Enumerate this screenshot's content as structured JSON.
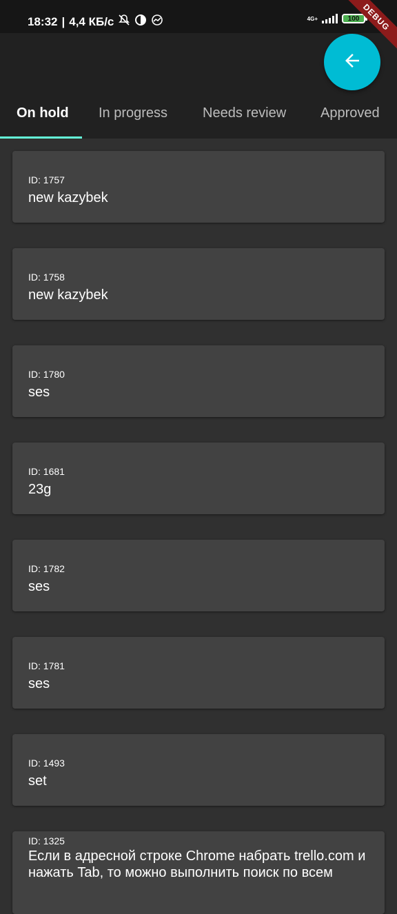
{
  "status_bar": {
    "time": "18:32",
    "separator": "|",
    "speed": "4,4 КБ/с",
    "network": "4G+",
    "battery": "100"
  },
  "debug_banner": "DEBUG",
  "tabs": [
    {
      "label": "On hold",
      "active": true
    },
    {
      "label": "In progress",
      "active": false
    },
    {
      "label": "Needs review",
      "active": false
    },
    {
      "label": "Approved",
      "active": false
    }
  ],
  "colors": {
    "accent_fab": "#00bcd4",
    "tab_indicator": "#64ffda",
    "background": "#303030",
    "card": "#424242"
  },
  "cards": [
    {
      "id": "ID: 1757",
      "title": "new kazybek"
    },
    {
      "id": "ID: 1758",
      "title": "new kazybek"
    },
    {
      "id": "ID: 1780",
      "title": "ses"
    },
    {
      "id": "ID: 1681",
      "title": "23g"
    },
    {
      "id": "ID: 1782",
      "title": "ses"
    },
    {
      "id": "ID: 1781",
      "title": "ses"
    },
    {
      "id": "ID: 1493",
      "title": "set"
    },
    {
      "id": "ID: 1325",
      "title": "Если в адресной строке Chrome набрать trello.com и нажать Tab, то можно выполнить поиск по всем"
    }
  ]
}
